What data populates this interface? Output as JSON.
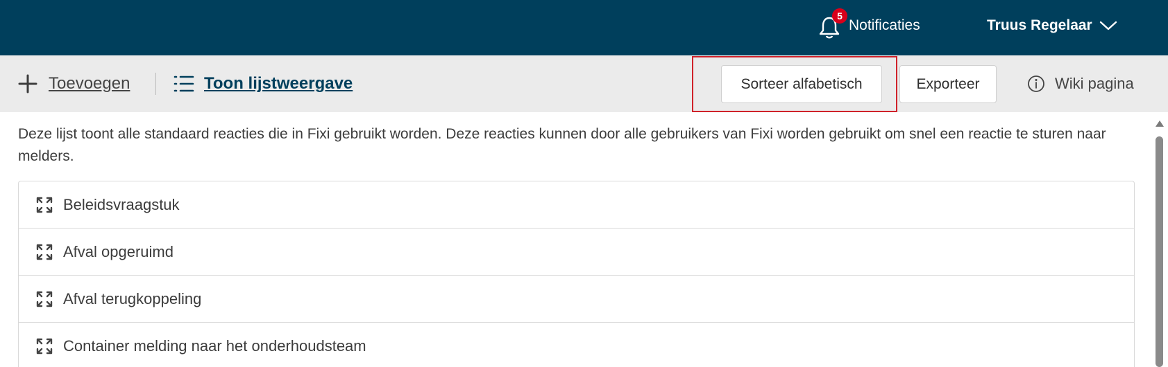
{
  "header": {
    "notifications": {
      "count": "5",
      "label": "Notificaties",
      "icon": "bell-icon"
    },
    "user": {
      "name": "Truus Regelaar",
      "icon": "chevron-down-icon"
    },
    "colors": {
      "background": "#003f5c",
      "badge": "#d9001b"
    }
  },
  "toolbar": {
    "add_label": "Toevoegen",
    "list_view_label": "Toon lijstweergave",
    "sort_label": "Sorteer alfabetisch",
    "export_label": "Exporteer",
    "wiki_label": "Wiki pagina",
    "highlight_color": "#d0222a"
  },
  "description": "Deze lijst toont alle standaard reacties die in Fixi gebruikt worden. Deze reacties kunnen door alle gebruikers van Fixi worden gebruikt om snel een reactie te sturen naar melders.",
  "items": [
    {
      "label": "Beleidsvraagstuk"
    },
    {
      "label": "Afval opgeruimd"
    },
    {
      "label": "Afval terugkoppeling"
    },
    {
      "label": "Container melding naar het onderhoudsteam"
    }
  ]
}
